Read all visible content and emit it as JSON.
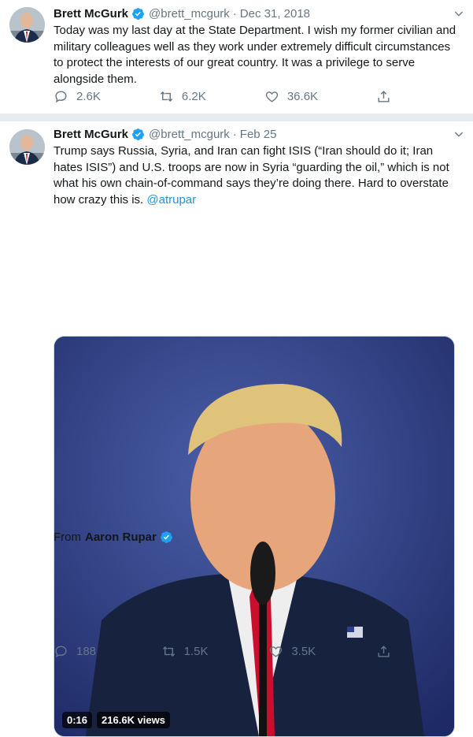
{
  "tweets": [
    {
      "name": "Brett McGurk",
      "handle": "@brett_mcgurk",
      "separator": "·",
      "date": "Dec 31, 2018",
      "text": "Today was my last day at the State Department. I wish my former civilian and military colleagues well as they work under extremely difficult circumstances to protect the interests of our great country. It was a privilege to serve alongside them.",
      "replies": "2.6K",
      "retweets": "6.2K",
      "likes": "36.6K"
    },
    {
      "name": "Brett McGurk",
      "handle": "@brett_mcgurk",
      "separator": "·",
      "date": "Feb 25",
      "text": "Trump says Russia, Syria, and Iran can fight ISIS (“Iran should do it; Iran hates ISIS”) and U.S. troops are now in Syria “guarding the oil,” which is not what his own chain-of-command says they’re doing there. Hard to overstate how crazy this is.",
      "mention": "@atrupar",
      "video": {
        "duration": "0:16",
        "views": "216.6K views"
      },
      "from_label": "From",
      "from_name": "Aaron Rupar",
      "replies": "188",
      "retweets": "1.5K",
      "likes": "3.5K"
    }
  ],
  "colors": {
    "accent": "#1da1f2",
    "muted": "#657786",
    "link": "#1b95e0"
  },
  "icons": [
    "verified-badge-icon",
    "caret-down-icon",
    "reply-icon",
    "retweet-icon",
    "like-icon",
    "share-icon"
  ]
}
